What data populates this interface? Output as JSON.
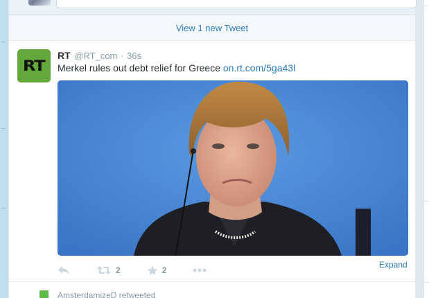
{
  "new_tweets_bar": {
    "label": "View 1 new Tweet"
  },
  "tweet": {
    "fullname": "RT",
    "username": "@RT_com",
    "separator": "·",
    "time": "36s",
    "avatar_text": "RT",
    "text": "Merkel rules out debt relief for Greece",
    "link": "on.rt.com/5ga43l",
    "retweet_count": "2",
    "favorite_count": "2",
    "expand_label": "Expand",
    "photo_alt": "photo",
    "icons": {
      "reply": "reply-icon",
      "retweet": "retweet-icon",
      "favorite": "star-icon",
      "more": "more-icon"
    }
  },
  "next_tweet": {
    "context": "AmsterdamizeD retweeted"
  },
  "colors": {
    "link": "#2b7bb9",
    "avatar_bg": "#62a83b",
    "photo_bg": "#4c8fdc",
    "muted": "#8899a6",
    "border": "#e1e8ed"
  }
}
